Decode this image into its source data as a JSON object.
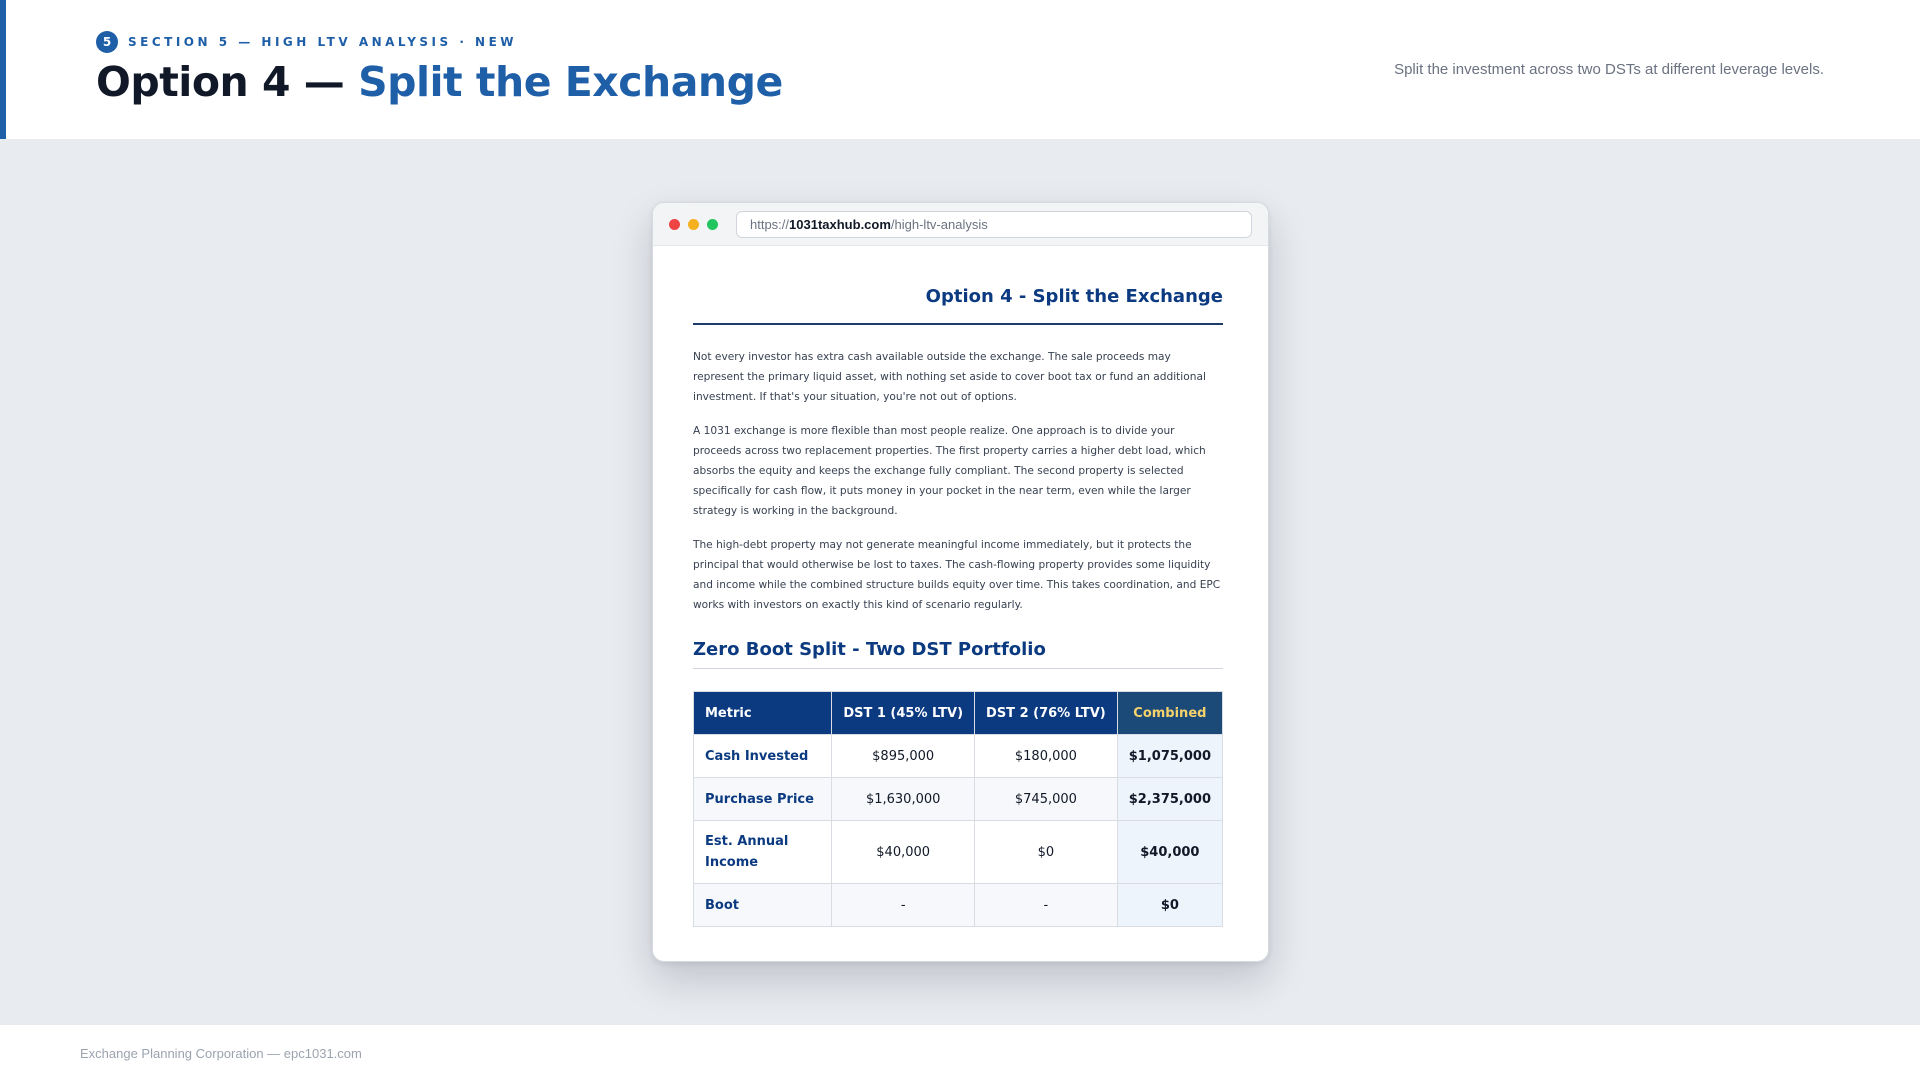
{
  "header": {
    "section_number": "5",
    "eyebrow": "Section 5 — High LTV Analysis · New",
    "title_main": "Option 4 — ",
    "title_accent": "Split the Exchange",
    "subtitle": "Split the investment across two DSTs at different leverage levels.",
    "accent_color": "#1f5fa8"
  },
  "browser": {
    "url_scheme": "https://",
    "url_host": "1031taxhub.com",
    "url_path": "/high-ltv-analysis"
  },
  "document": {
    "title": "Option 4 - Split the Exchange",
    "paragraphs": [
      "Not every investor has extra cash available outside the exchange. The sale proceeds may represent the primary liquid asset, with nothing set aside to cover boot tax or fund an additional investment. If that's your situation, you're not out of options.",
      "A 1031 exchange is more flexible than most people realize. One approach is to divide your proceeds across two replacement properties. The first property carries a higher debt load, which absorbs the equity and keeps the exchange fully compliant. The second property is selected specifically for cash flow, it puts money in your pocket in the near term, even while the larger strategy is working in the background.",
      "The high-debt property may not generate meaningful income immediately, but it protects the principal that would otherwise be lost to taxes. The cash-flowing property provides some liquidity and income while the combined structure builds equity over time. This takes coordination, and EPC works with investors on exactly this kind of scenario regularly."
    ],
    "section_title": "Zero Boot Split - Two DST Portfolio"
  },
  "table": {
    "headers": [
      "Metric",
      "DST 1 (45% LTV)",
      "DST 2 (76% LTV)",
      "Combined"
    ],
    "rows": [
      [
        "Cash Invested",
        "$895,000",
        "$180,000",
        "$1,075,000"
      ],
      [
        "Purchase Price",
        "$1,630,000",
        "$745,000",
        "$2,375,000"
      ],
      [
        "Est. Annual Income",
        "$40,000",
        "$0",
        "$40,000"
      ],
      [
        "Boot",
        "-",
        "-",
        "$0"
      ]
    ]
  },
  "footer": {
    "text": "Exchange Planning Corporation — epc1031.com"
  }
}
